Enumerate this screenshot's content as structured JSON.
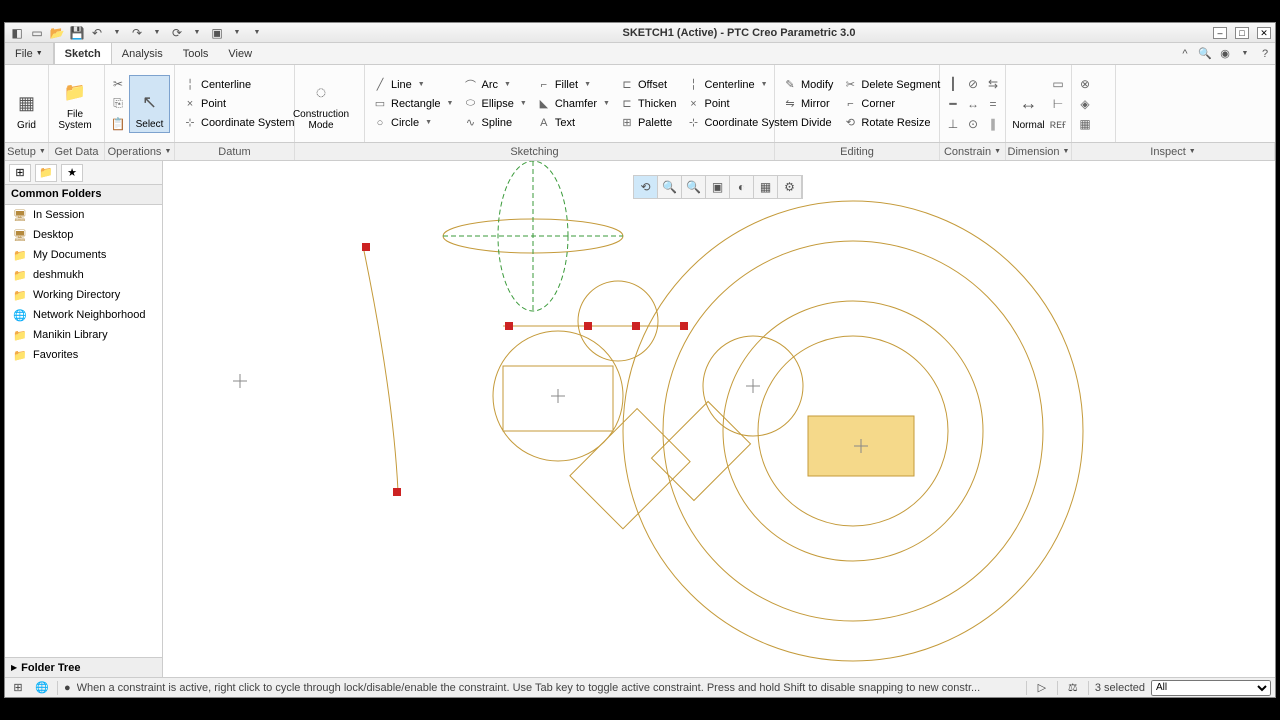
{
  "title": "SKETCH1 (Active) - PTC Creo Parametric 3.0",
  "menu": {
    "file": "File",
    "sketch": "Sketch",
    "analysis": "Analysis",
    "tools": "Tools",
    "view": "View"
  },
  "ribbon": {
    "grid": "Grid",
    "filesystem": "File\nSystem",
    "select": "Select",
    "centerline": "Centerline",
    "point": "Point",
    "coordsys": "Coordinate System",
    "construction": "Construction\nMode",
    "line": "Line",
    "rectangle": "Rectangle",
    "circle": "Circle",
    "arc": "Arc",
    "ellipse": "Ellipse",
    "spline": "Spline",
    "fillet": "Fillet",
    "chamfer": "Chamfer",
    "text": "Text",
    "offset": "Offset",
    "thicken": "Thicken",
    "palette": "Palette",
    "centerline2": "Centerline",
    "point2": "Point",
    "coordsys2": "Coordinate System",
    "modify": "Modify",
    "mirror": "Mirror",
    "divide": "Divide",
    "deleteseg": "Delete Segment",
    "corner": "Corner",
    "rotresize": "Rotate Resize",
    "normal": "Normal"
  },
  "groups": {
    "setup": "Setup",
    "getdata": "Get Data",
    "operations": "Operations",
    "datum": "Datum",
    "sketching": "Sketching",
    "editing": "Editing",
    "constrain": "Constrain",
    "dimension": "Dimension",
    "inspect": "Inspect"
  },
  "sidebar": {
    "header": "Common Folders",
    "items": [
      {
        "icon": "🖥",
        "label": "In Session"
      },
      {
        "icon": "🖥",
        "label": "Desktop"
      },
      {
        "icon": "📁",
        "label": "My Documents"
      },
      {
        "icon": "📁",
        "label": "deshmukh"
      },
      {
        "icon": "📁",
        "label": "Working Directory"
      },
      {
        "icon": "🌐",
        "label": "Network Neighborhood"
      },
      {
        "icon": "📁",
        "label": "Manikin Library"
      },
      {
        "icon": "📁",
        "label": "Favorites"
      }
    ],
    "footer": "Folder Tree"
  },
  "status": {
    "msg": "When a constraint is active, right click to cycle through lock/disable/enable the constraint. Use Tab key to toggle active constraint. Press and hold Shift to disable snapping to new constr...",
    "selcount": "3 selected",
    "filter": "All"
  }
}
